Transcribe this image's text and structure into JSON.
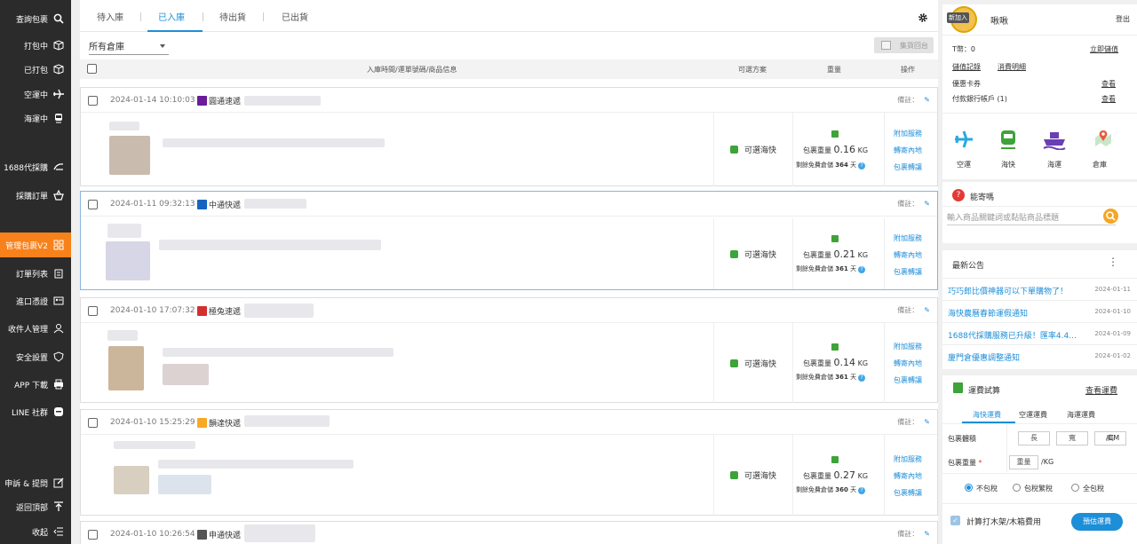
{
  "sidebar": {
    "items": [
      {
        "label": "查詢包裹",
        "icon": "search-icon"
      },
      {
        "label": "打包中",
        "icon": "box-icon"
      },
      {
        "label": "已打包",
        "icon": "package-icon"
      },
      {
        "label": "空運中",
        "icon": "airplane-icon"
      },
      {
        "label": "海運中",
        "icon": "ship-icon"
      },
      {
        "label": "1688代採購",
        "icon": "cart-icon"
      },
      {
        "label": "採購訂單",
        "icon": "basket-icon"
      },
      {
        "label": "管理包裹V2",
        "icon": "grid-icon"
      },
      {
        "label": "訂單列表",
        "icon": "clipboard-icon"
      },
      {
        "label": "進口憑證",
        "icon": "id-card-icon"
      },
      {
        "label": "收件人管理",
        "icon": "person-icon"
      },
      {
        "label": "安全設置",
        "icon": "shield-icon"
      },
      {
        "label": "APP 下載",
        "icon": "printer-icon"
      },
      {
        "label": "LINE 社群",
        "icon": "chat-icon"
      },
      {
        "label": "申訴 & 提問",
        "icon": "edit-icon"
      },
      {
        "label": "返回頂部",
        "icon": "arrow-up-icon"
      },
      {
        "label": "收起",
        "icon": "collapse-icon"
      }
    ]
  },
  "tabs": [
    "待入庫",
    "已入庫",
    "待出貨",
    "已出貨"
  ],
  "warehouse_select": "所有倉庫",
  "mail_button": "集貨回台",
  "table_header": {
    "col_info": "入庫時間/運單號碼/商品信息",
    "col_shipping": "可選方案",
    "col_weight": "重量",
    "col_action": "操作"
  },
  "note_label": "備註：",
  "shipping_option": "可選海快",
  "weight_prefix": "包裹重量",
  "weight_unit": "KG",
  "free_prefix": "剩餘免費倉儲",
  "free_suffix": "天",
  "actions": [
    "附加服務",
    "轉寄內地",
    "包裹轉讓"
  ],
  "packages": [
    {
      "date": "2024-01-14 10:10:03",
      "courier": "圓通速遞",
      "logo_color": "#6a1b9a",
      "weight": "0.16",
      "free_days": "364"
    },
    {
      "date": "2024-01-11 09:32:13",
      "courier": "中通快遞",
      "logo_color": "#1565c0",
      "weight": "0.21",
      "free_days": "361"
    },
    {
      "date": "2024-01-10 17:07:32",
      "courier": "極兔速遞",
      "logo_color": "#d32f2f",
      "weight": "0.14",
      "free_days": "361"
    },
    {
      "date": "2024-01-10 15:25:29",
      "courier": "韻達快遞",
      "logo_color": "#f9a825",
      "weight": "0.27",
      "free_days": "360"
    },
    {
      "date": "2024-01-10 10:26:54",
      "courier": "申通快遞",
      "logo_color": "#555555",
      "weight": "",
      "free_days": ""
    }
  ],
  "account": {
    "avatar_badge": "新加入",
    "name": "啾啾",
    "logout": "登出",
    "balance": "T幣：0",
    "topup": "立即儲值",
    "stored_record": "儲值記錄",
    "spend_detail": "消費明細",
    "coupons": "優惠卡券",
    "coupons_view": "查看",
    "bank": "付款銀行帳戶 (1)",
    "bank_view": "查看"
  },
  "quick_links": [
    {
      "label": "空運",
      "icon": "airplane-icon",
      "color": "#29a9e0"
    },
    {
      "label": "海快",
      "icon": "train-icon",
      "color": "#3ea338"
    },
    {
      "label": "海運",
      "icon": "cargo-ship-icon",
      "color": "#6a3fb5"
    },
    {
      "label": "倉庫",
      "icon": "map-pin-icon",
      "color": "#e85a3c"
    }
  ],
  "prohibited": {
    "title": "能寄嗎",
    "placeholder": "輸入商品關鍵詞或黏貼商品標題"
  },
  "news": {
    "title": "最新公告",
    "items": [
      {
        "title": "巧巧郎比價神器可以下單購物了！",
        "date": "2024-01-11"
      },
      {
        "title": "海快農曆春節運假通知",
        "date": "2024-01-10"
      },
      {
        "title": "1688代採購服務已升級！匯率4.4...",
        "date": "2024-01-09"
      },
      {
        "title": "廈門倉優惠調整通知",
        "date": "2024-01-02"
      }
    ]
  },
  "calculator": {
    "title": "運費試算",
    "view_link": "查看運費",
    "tabs": [
      "海快運費",
      "空運運費",
      "海運運費"
    ],
    "volume_label": "包裹體積",
    "length": "長",
    "width": "寬",
    "height": "高",
    "cm_unit": "/CM",
    "weight_label": "包裹重量",
    "required_mark": "*",
    "weight_placeholder": "重量",
    "kg_unit": "/KG",
    "tax_options": [
      "不包稅",
      "包稅繁稅",
      "全包稅"
    ],
    "wood_frame": "計算打木架/木箱費用",
    "estimate_button": "預估運費"
  }
}
